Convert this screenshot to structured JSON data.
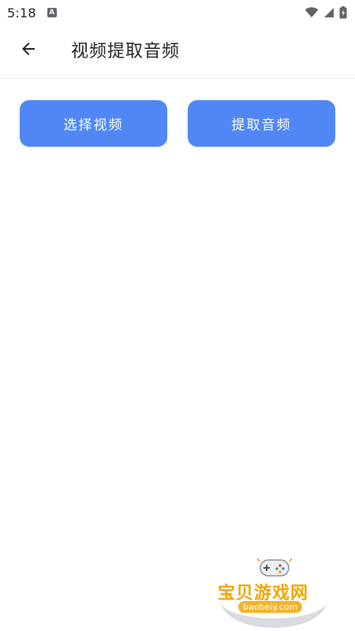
{
  "status_bar": {
    "time": "5:18",
    "notification_badge": "A"
  },
  "app_bar": {
    "title": "视频提取音频"
  },
  "actions": {
    "select_video_label": "选择视频",
    "extract_audio_label": "提取音频"
  },
  "watermark": {
    "title": "宝贝游戏网",
    "url": "baobeiy.com"
  },
  "colors": {
    "primary_button": "#5087f4",
    "watermark_gold": "#f2a500"
  }
}
